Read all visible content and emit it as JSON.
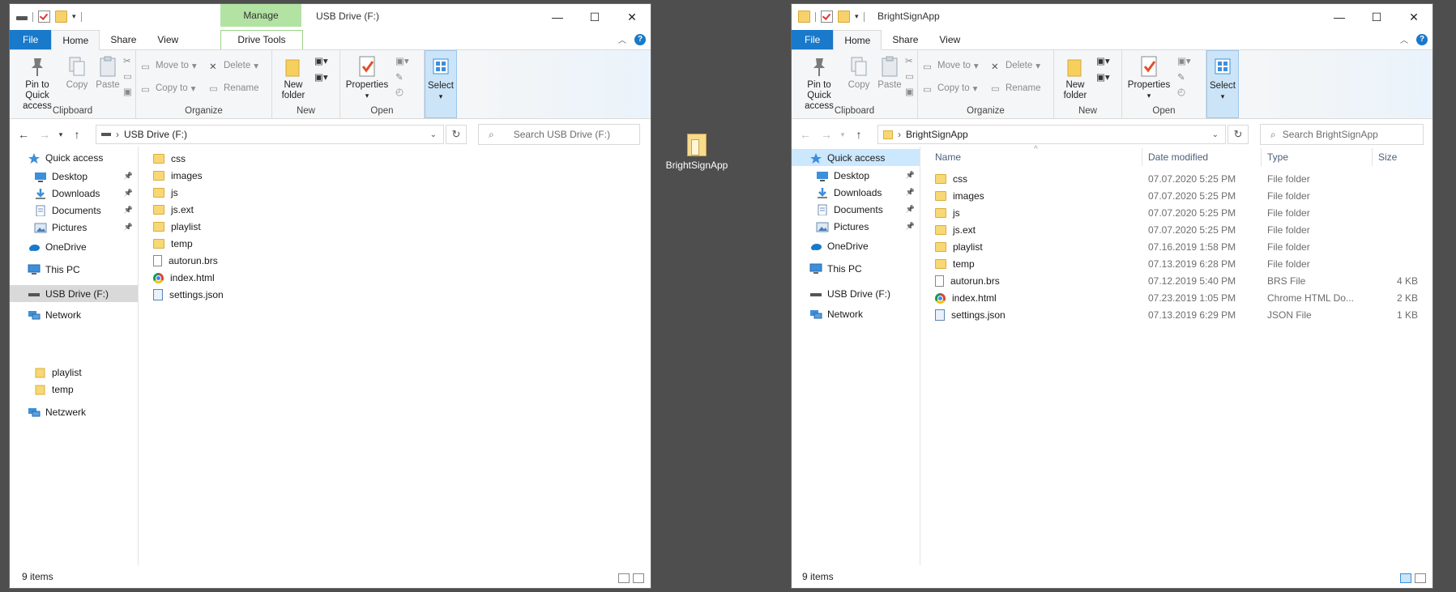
{
  "window1": {
    "title": "USB Drive (F:)",
    "context_tab_header": "Manage",
    "tabs": [
      "File",
      "Home",
      "Share",
      "View",
      "Drive Tools"
    ],
    "ribbon": {
      "clipboard": {
        "pin": "Pin to Quick access",
        "copy": "Copy",
        "paste": "Paste",
        "label": "Clipboard"
      },
      "organize": {
        "move_to": "Move to",
        "copy_to": "Copy to",
        "delete": "Delete",
        "rename": "Rename",
        "label": "Organize"
      },
      "new": {
        "new_folder": "New folder",
        "label": "New"
      },
      "open": {
        "properties": "Properties",
        "label": "Open"
      },
      "select": {
        "select": "Select"
      }
    },
    "address": "USB Drive (F:)",
    "search_placeholder": "Search   USB Drive (F:)",
    "nav": [
      {
        "label": "Quick access",
        "icon": "star-icon"
      },
      {
        "label": "Desktop",
        "icon": "desktop-icon",
        "pinned": true
      },
      {
        "label": "Downloads",
        "icon": "download-icon",
        "pinned": true
      },
      {
        "label": "Documents",
        "icon": "documents-icon",
        "pinned": true
      },
      {
        "label": "Pictures",
        "icon": "pictures-icon",
        "pinned": true
      },
      {
        "label": "OneDrive",
        "icon": "cloud-icon"
      },
      {
        "label": "This PC",
        "icon": "pc-icon"
      },
      {
        "label": "USB Drive (F:)",
        "icon": "drive-icon",
        "selected": true
      },
      {
        "label": "Network",
        "icon": "network-icon"
      },
      {
        "label": "playlist",
        "icon": "folder-icon"
      },
      {
        "label": "temp",
        "icon": "folder-icon"
      },
      {
        "label": "Netzwerk",
        "icon": "network-icon"
      }
    ],
    "files": [
      {
        "name": "css",
        "icon": "folder-icon"
      },
      {
        "name": "images",
        "icon": "folder-icon"
      },
      {
        "name": "js",
        "icon": "folder-icon"
      },
      {
        "name": "js.ext",
        "icon": "folder-icon"
      },
      {
        "name": "playlist",
        "icon": "folder-icon"
      },
      {
        "name": "temp",
        "icon": "folder-icon"
      },
      {
        "name": "autorun.brs",
        "icon": "file-icon"
      },
      {
        "name": "index.html",
        "icon": "chrome-icon"
      },
      {
        "name": "settings.json",
        "icon": "json-icon"
      }
    ],
    "status": "9 items"
  },
  "desktop_icon": {
    "label": "BrightSignApp"
  },
  "window2": {
    "title": "BrightSignApp",
    "tabs": [
      "File",
      "Home",
      "Share",
      "View"
    ],
    "ribbon": {
      "clipboard": {
        "pin": "Pin to Quick access",
        "copy": "Copy",
        "paste": "Paste",
        "label": "Clipboard"
      },
      "organize": {
        "move_to": "Move to",
        "copy_to": "Copy to",
        "delete": "Delete",
        "rename": "Rename",
        "label": "Organize"
      },
      "new": {
        "new_folder": "New folder",
        "label": "New"
      },
      "open": {
        "properties": "Properties",
        "label": "Open"
      },
      "select": {
        "select": "Select"
      }
    },
    "address": "BrightSignApp",
    "search_placeholder": "Search BrightSignApp",
    "nav": [
      {
        "label": "Quick access",
        "icon": "star-icon",
        "selected": true
      },
      {
        "label": "Desktop",
        "icon": "desktop-icon",
        "pinned": true
      },
      {
        "label": "Downloads",
        "icon": "download-icon",
        "pinned": true
      },
      {
        "label": "Documents",
        "icon": "documents-icon",
        "pinned": true
      },
      {
        "label": "Pictures",
        "icon": "pictures-icon",
        "pinned": true
      },
      {
        "label": "OneDrive",
        "icon": "cloud-icon"
      },
      {
        "label": "This PC",
        "icon": "pc-icon"
      },
      {
        "label": "USB  Drive  (F:)",
        "icon": "drive-icon"
      },
      {
        "label": "Network",
        "icon": "network-icon"
      }
    ],
    "columns": [
      "Name",
      "Date modified",
      "Type",
      "Size"
    ],
    "files": [
      {
        "name": "css",
        "date": "07.07.2020 5:25  PM",
        "type": "File folder",
        "size": "",
        "icon": "folder-icon"
      },
      {
        "name": "images",
        "date": "07.07.2020 5:25  PM",
        "type": "File folder",
        "size": "",
        "icon": "folder-icon"
      },
      {
        "name": "js",
        "date": "07.07.2020 5:25  PM",
        "type": "File folder",
        "size": "",
        "icon": "folder-icon"
      },
      {
        "name": "js.ext",
        "date": "07.07.2020 5:25  PM",
        "type": "File folder",
        "size": "",
        "icon": "folder-icon"
      },
      {
        "name": "playlist",
        "date": "07.16.2019 1:58  PM",
        "type": "File folder",
        "size": "",
        "icon": "folder-icon"
      },
      {
        "name": "temp",
        "date": "07.13.2019 6:28  PM",
        "type": "File folder",
        "size": "",
        "icon": "folder-icon"
      },
      {
        "name": "autorun.brs",
        "date": "07.12.2019 5:40  PM",
        "type": "BRS File",
        "size": "4 KB",
        "icon": "file-icon"
      },
      {
        "name": "index.html",
        "date": "07.23.2019 1:05  PM",
        "type": "Chrome HTML Do...",
        "size": "2 KB",
        "icon": "chrome-icon"
      },
      {
        "name": "settings.json",
        "date": "07.13.2019 6:29  PM",
        "type": "JSON File",
        "size": "1 KB",
        "icon": "json-icon"
      }
    ],
    "status": "9 items"
  }
}
